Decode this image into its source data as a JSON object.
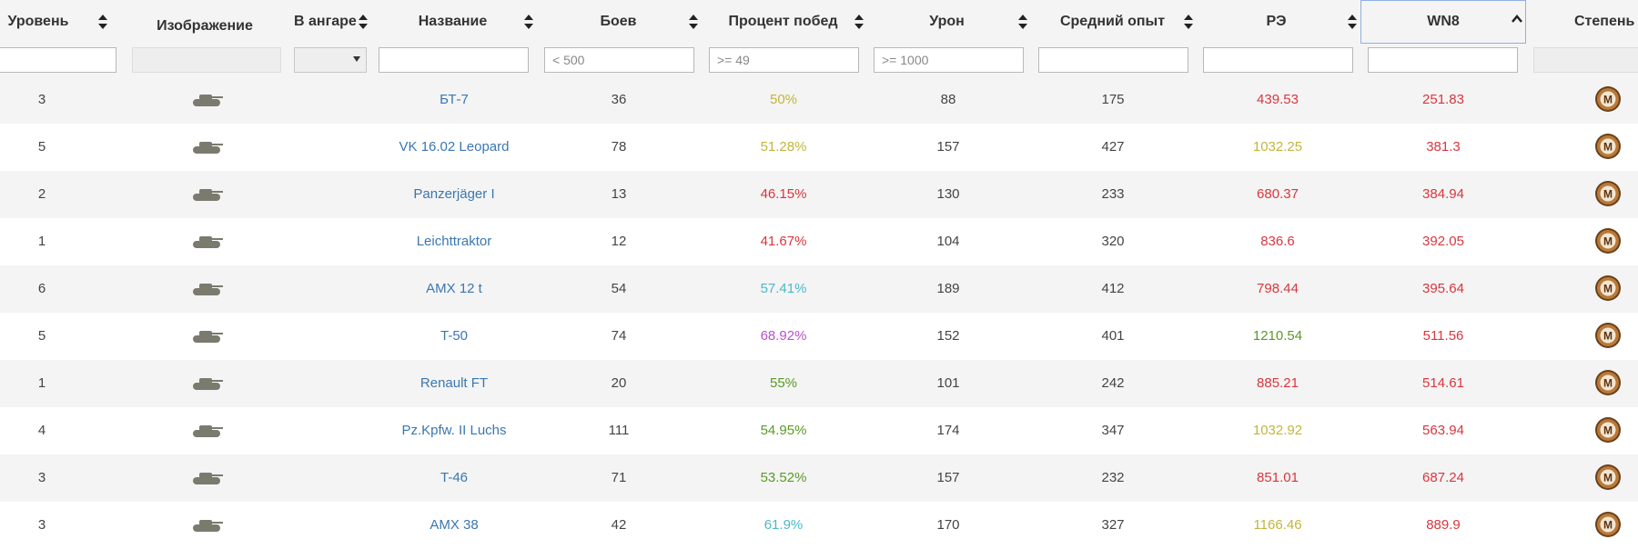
{
  "table": {
    "headers": {
      "level": "Уровень",
      "image": "Изображение",
      "hangar": "В ангаре",
      "name": "Название",
      "battles": "Боев",
      "winrate": "Процент побед",
      "damage": "Урон",
      "avg_xp": "Средний опыт",
      "re": "РЭ",
      "wn8": "WN8",
      "mastery": "Степень"
    },
    "sort": {
      "active_column": "WN8",
      "direction": "ascending"
    },
    "filters": {
      "level": "",
      "hangar_selected": "",
      "name": "",
      "battles": "",
      "battles_placeholder": "< 500",
      "winrate": "",
      "winrate_placeholder": ">= 49",
      "damage": "",
      "damage_placeholder": ">= 1000",
      "avg_xp": "",
      "re": "",
      "wn8": ""
    },
    "colors": {
      "link": "#3a77b0",
      "red": "#d9363e",
      "olive": "#c2b53a",
      "green": "#5a9a25",
      "teal": "#4bb8c9",
      "purple": "#b94fce",
      "mastery_badge": "#b8793a",
      "tank_icon": "#7a7a6e"
    },
    "rows": [
      {
        "level": "3",
        "tank_icon": "tank-silhouette-icon",
        "name": "БТ-7",
        "battles": "36",
        "winrate": "50%",
        "winrate_color": "#c2b53a",
        "damage": "88",
        "avg_xp": "175",
        "re": "439.53",
        "re_color": "#d9363e",
        "wn8": "251.83",
        "wn8_color": "#d9363e",
        "mastery": "М"
      },
      {
        "level": "5",
        "tank_icon": "tank-silhouette-icon",
        "name": "VK 16.02 Leopard",
        "battles": "78",
        "winrate": "51.28%",
        "winrate_color": "#c2b53a",
        "damage": "157",
        "avg_xp": "427",
        "re": "1032.25",
        "re_color": "#c2b53a",
        "wn8": "381.3",
        "wn8_color": "#d9363e",
        "mastery": "М"
      },
      {
        "level": "2",
        "tank_icon": "tank-silhouette-icon",
        "name": "Panzerjäger I",
        "battles": "13",
        "winrate": "46.15%",
        "winrate_color": "#d9363e",
        "damage": "130",
        "avg_xp": "233",
        "re": "680.37",
        "re_color": "#d9363e",
        "wn8": "384.94",
        "wn8_color": "#d9363e",
        "mastery": "М"
      },
      {
        "level": "1",
        "tank_icon": "tank-silhouette-icon",
        "name": "Leichttraktor",
        "battles": "12",
        "winrate": "41.67%",
        "winrate_color": "#d9363e",
        "damage": "104",
        "avg_xp": "320",
        "re": "836.6",
        "re_color": "#d9363e",
        "wn8": "392.05",
        "wn8_color": "#d9363e",
        "mastery": "М"
      },
      {
        "level": "6",
        "tank_icon": "tank-silhouette-icon",
        "name": "AMX 12 t",
        "battles": "54",
        "winrate": "57.41%",
        "winrate_color": "#4bb8c9",
        "damage": "189",
        "avg_xp": "412",
        "re": "798.44",
        "re_color": "#d9363e",
        "wn8": "395.64",
        "wn8_color": "#d9363e",
        "mastery": "М"
      },
      {
        "level": "5",
        "tank_icon": "tank-silhouette-icon",
        "name": "T-50",
        "battles": "74",
        "winrate": "68.92%",
        "winrate_color": "#b94fce",
        "damage": "152",
        "avg_xp": "401",
        "re": "1210.54",
        "re_color": "#5a9a25",
        "wn8": "511.56",
        "wn8_color": "#d9363e",
        "mastery": "М"
      },
      {
        "level": "1",
        "tank_icon": "tank-silhouette-icon",
        "name": "Renault FT",
        "battles": "20",
        "winrate": "55%",
        "winrate_color": "#5a9a25",
        "damage": "101",
        "avg_xp": "242",
        "re": "885.21",
        "re_color": "#d9363e",
        "wn8": "514.61",
        "wn8_color": "#d9363e",
        "mastery": "М"
      },
      {
        "level": "4",
        "tank_icon": "tank-silhouette-icon",
        "name": "Pz.Kpfw. II Luchs",
        "battles": "111",
        "winrate": "54.95%",
        "winrate_color": "#5a9a25",
        "damage": "174",
        "avg_xp": "347",
        "re": "1032.92",
        "re_color": "#c2b53a",
        "wn8": "563.94",
        "wn8_color": "#d9363e",
        "mastery": "М"
      },
      {
        "level": "3",
        "tank_icon": "tank-silhouette-icon",
        "name": "T-46",
        "battles": "71",
        "winrate": "53.52%",
        "winrate_color": "#5a9a25",
        "damage": "157",
        "avg_xp": "232",
        "re": "851.01",
        "re_color": "#d9363e",
        "wn8": "687.24",
        "wn8_color": "#d9363e",
        "mastery": "М"
      },
      {
        "level": "3",
        "tank_icon": "tank-silhouette-icon",
        "name": "AMX 38",
        "battles": "42",
        "winrate": "61.9%",
        "winrate_color": "#4bb8c9",
        "damage": "170",
        "avg_xp": "327",
        "re": "1166.46",
        "re_color": "#c2b53a",
        "wn8": "889.9",
        "wn8_color": "#d9363e",
        "mastery": "М"
      }
    ]
  }
}
